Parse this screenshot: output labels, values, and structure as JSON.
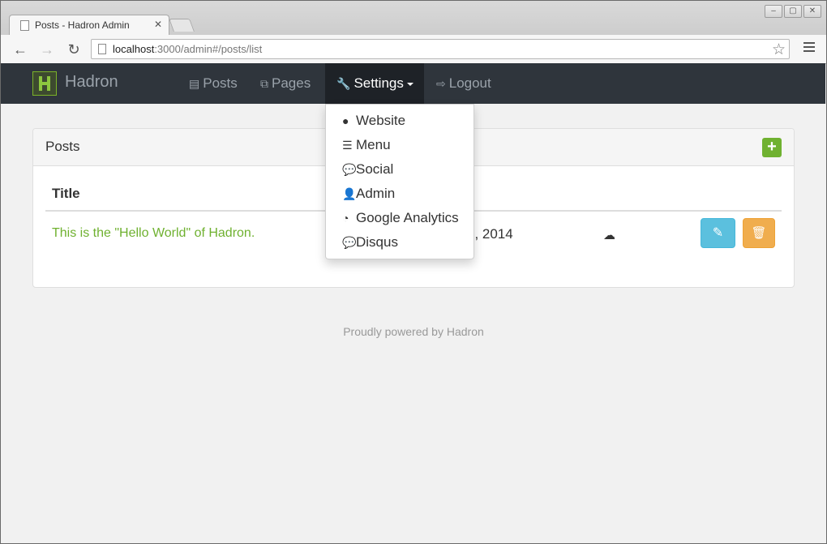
{
  "browser": {
    "tab_title": "Posts - Hadron Admin",
    "url_host": "localhost",
    "url_path": ":3000/admin#/posts/list"
  },
  "navbar": {
    "brand": "Hadron",
    "links": [
      {
        "label": "Posts",
        "icon": "list-alt-icon"
      },
      {
        "label": "Pages",
        "icon": "copy-icon"
      },
      {
        "label": "Settings",
        "icon": "wrench-icon",
        "active": true
      },
      {
        "label": "Logout",
        "icon": "sign-out-icon"
      }
    ]
  },
  "settings_menu": [
    {
      "label": "Website",
      "icon": "globe-icon"
    },
    {
      "label": "Menu",
      "icon": "list-icon"
    },
    {
      "label": "Social",
      "icon": "comment-icon"
    },
    {
      "label": "Admin",
      "icon": "user-icon"
    },
    {
      "label": "Google Analytics",
      "icon": "dashboard-icon"
    },
    {
      "label": "Disqus",
      "icon": "comments-icon"
    }
  ],
  "panel": {
    "title": "Posts",
    "columns": [
      "Title"
    ],
    "rows": [
      {
        "title": "This is the \"Hello World\" of Hadron.",
        "date_fragment": "7, 2014",
        "status_icon": "cloud-icon"
      }
    ]
  },
  "footer": "Proudly powered by Hadron",
  "colors": {
    "navbar": "#2f353c",
    "brand_green": "#6fb130",
    "edit": "#5bc0de",
    "delete": "#f0ad4e"
  }
}
